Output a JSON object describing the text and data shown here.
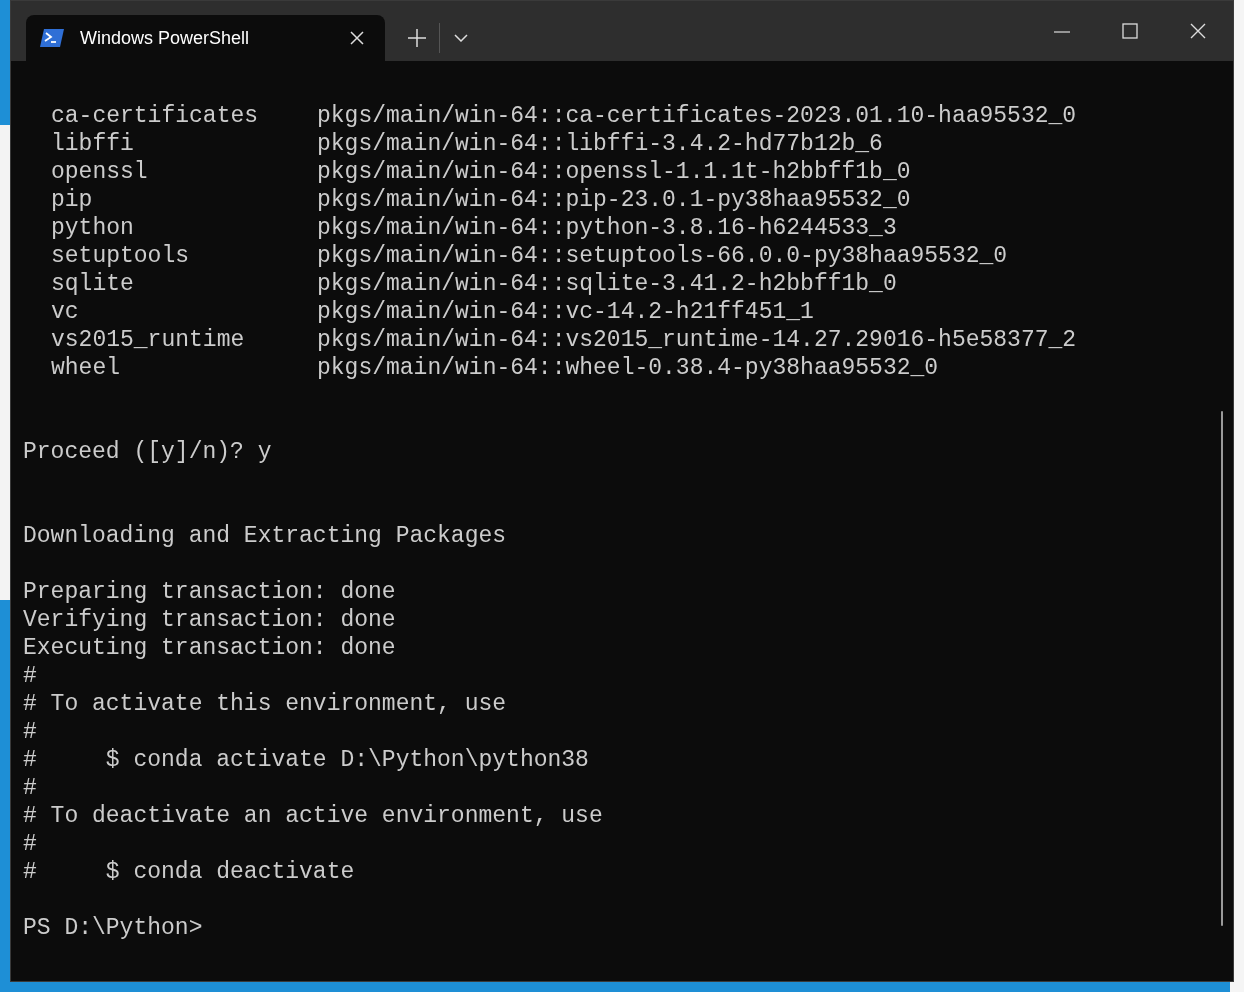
{
  "tab": {
    "title": "Windows PowerShell",
    "selected": true
  },
  "packages": [
    {
      "name": "ca-certificates",
      "spec": "pkgs/main/win-64::ca-certificates-2023.01.10-haa95532_0"
    },
    {
      "name": "libffi",
      "spec": "pkgs/main/win-64::libffi-3.4.2-hd77b12b_6"
    },
    {
      "name": "openssl",
      "spec": "pkgs/main/win-64::openssl-1.1.1t-h2bbff1b_0"
    },
    {
      "name": "pip",
      "spec": "pkgs/main/win-64::pip-23.0.1-py38haa95532_0"
    },
    {
      "name": "python",
      "spec": "pkgs/main/win-64::python-3.8.16-h6244533_3"
    },
    {
      "name": "setuptools",
      "spec": "pkgs/main/win-64::setuptools-66.0.0-py38haa95532_0"
    },
    {
      "name": "sqlite",
      "spec": "pkgs/main/win-64::sqlite-3.41.2-h2bbff1b_0"
    },
    {
      "name": "vc",
      "spec": "pkgs/main/win-64::vc-14.2-h21ff451_1"
    },
    {
      "name": "vs2015_runtime",
      "spec": "pkgs/main/win-64::vs2015_runtime-14.27.29016-h5e58377_2"
    },
    {
      "name": "wheel",
      "spec": "pkgs/main/win-64::wheel-0.38.4-py38haa95532_0"
    }
  ],
  "lines": [
    {
      "kind": "blank"
    },
    {
      "kind": "blank"
    },
    {
      "kind": "text",
      "text": "Proceed ([y]/n)? y"
    },
    {
      "kind": "blank"
    },
    {
      "kind": "blank"
    },
    {
      "kind": "text",
      "text": "Downloading and Extracting Packages"
    },
    {
      "kind": "blank"
    },
    {
      "kind": "text",
      "text": "Preparing transaction: done"
    },
    {
      "kind": "text",
      "text": "Verifying transaction: done"
    },
    {
      "kind": "text",
      "text": "Executing transaction: done"
    },
    {
      "kind": "text",
      "text": "#"
    },
    {
      "kind": "text",
      "text": "# To activate this environment, use"
    },
    {
      "kind": "text",
      "text": "#"
    },
    {
      "kind": "text",
      "text": "#     $ conda activate D:\\Python\\python38"
    },
    {
      "kind": "text",
      "text": "#"
    },
    {
      "kind": "text",
      "text": "# To deactivate an active environment, use"
    },
    {
      "kind": "text",
      "text": "#"
    },
    {
      "kind": "text",
      "text": "#     $ conda deactivate"
    },
    {
      "kind": "blank"
    },
    {
      "kind": "text",
      "text": "PS D:\\Python>"
    }
  ]
}
